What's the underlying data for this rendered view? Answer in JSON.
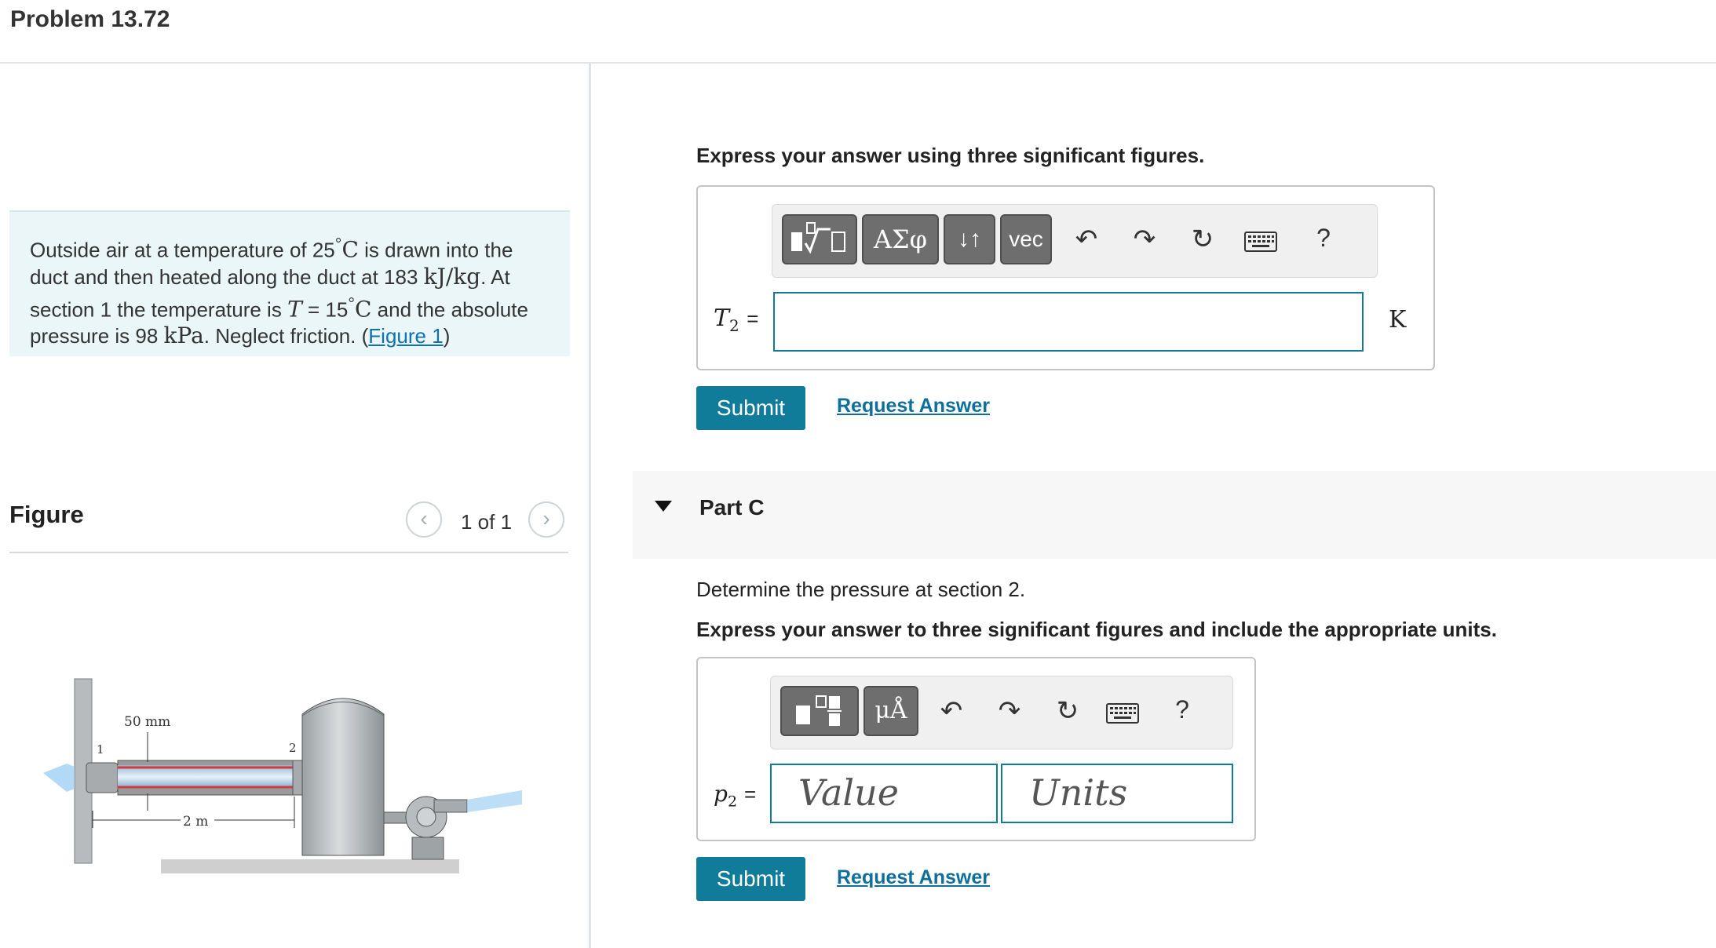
{
  "page_title": "Problem 13.72",
  "problem": {
    "t1": "Outside air at a temperature of 25",
    "deg": "°",
    "u_C": "C",
    "t2": " is drawn into the duct and then heated along the duct at 183 ",
    "u_kjkg": "kJ/kg",
    "t3": ". At section 1 the temperature is ",
    "var_T": "T",
    "t4": " = 15",
    "t5": " and the absolute pressure is 98 ",
    "u_kpa": "kPa",
    "t6": ". Neglect friction. (",
    "figure_link": "Figure 1",
    "t7": ")"
  },
  "figure": {
    "heading": "Figure",
    "pager": "1 of 1",
    "prev_icon": "chevron-left-icon",
    "next_icon": "chevron-right-icon",
    "label_50mm": "50 mm",
    "label_1": "1",
    "label_2": "2",
    "label_2m": "2 m"
  },
  "part_b": {
    "instruction": "Express your answer using three significant figures.",
    "toolbar": {
      "template_icon": "templates-icon",
      "greek": "ΑΣφ",
      "arrows": "↓↑",
      "vec": "vec",
      "undo_icon": "undo-icon",
      "redo_icon": "redo-icon",
      "reset_icon": "reset-icon",
      "keyboard_icon": "keyboard-icon",
      "help": "?"
    },
    "var_label": "T",
    "var_sub": "2",
    "equals": "=",
    "input_value": "",
    "unit": "K",
    "submit": "Submit",
    "request_answer": "Request Answer"
  },
  "part_c": {
    "label": "Part C",
    "question": "Determine the pressure at section 2.",
    "instruction": "Express your answer to three significant figures and include the appropriate units.",
    "toolbar": {
      "template_icon": "templates-icon",
      "units": "μÅ",
      "undo_icon": "undo-icon",
      "redo_icon": "redo-icon",
      "reset_icon": "reset-icon",
      "keyboard_icon": "keyboard-icon",
      "help": "?"
    },
    "var_label": "p",
    "var_sub": "2",
    "equals": "=",
    "value_placeholder": "Value",
    "units_placeholder": "Units",
    "submit": "Submit",
    "request_answer": "Request Answer"
  },
  "colors": {
    "accent": "#117c99",
    "link": "#0f70b4",
    "problem_bg": "#eaf6f7"
  }
}
